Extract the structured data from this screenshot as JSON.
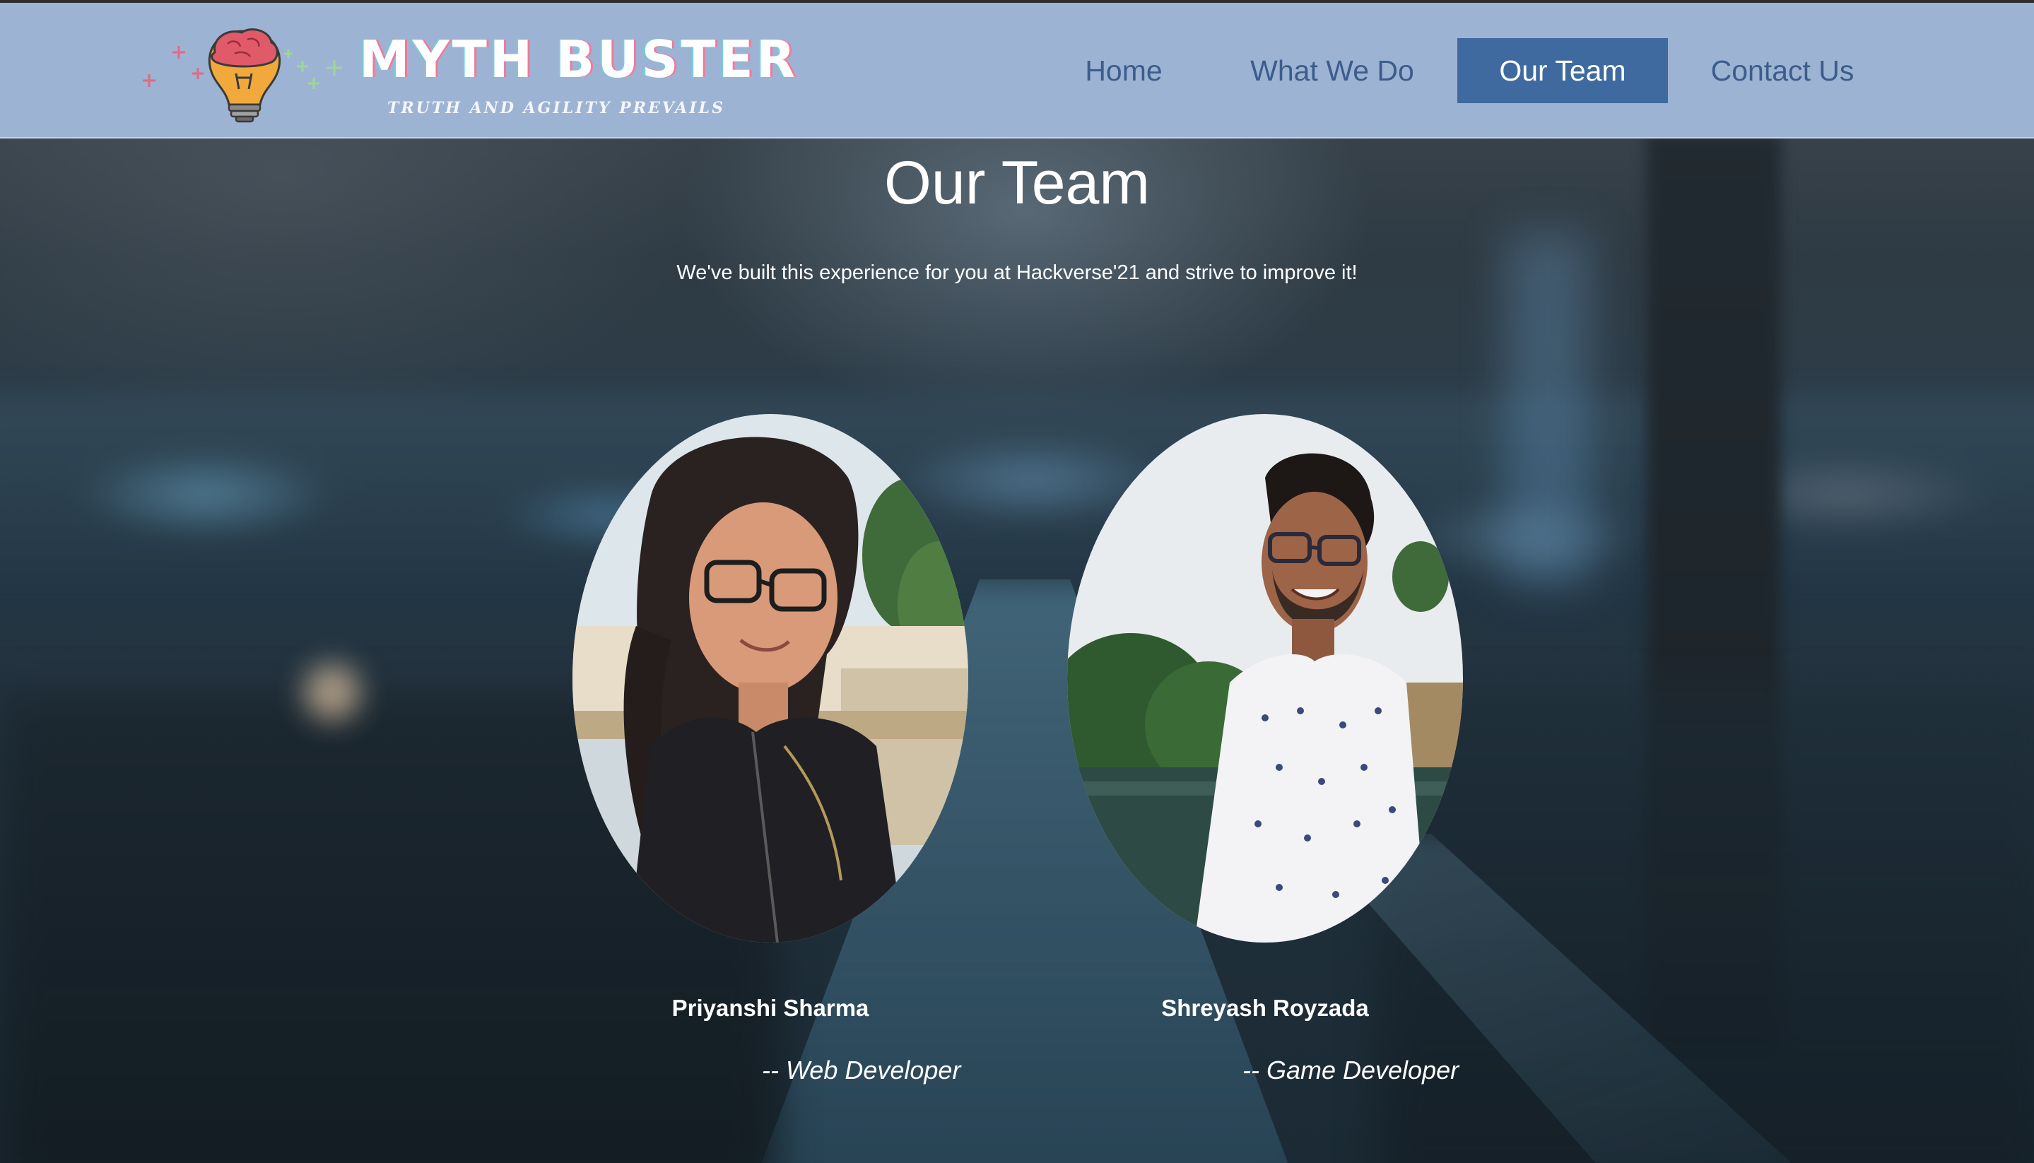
{
  "brand": {
    "title": "MYTH BUSTER",
    "tagline": "TRUTH AND AGILITY PREVAILS",
    "logo_icon": "lightbulb-brain-icon"
  },
  "nav": {
    "items": [
      {
        "label": "Home",
        "active": false
      },
      {
        "label": "What We Do",
        "active": false
      },
      {
        "label": "Our Team",
        "active": true
      },
      {
        "label": "Contact Us",
        "active": false
      }
    ]
  },
  "main": {
    "title": "Our Team",
    "subtitle": "We've built this experience for you at Hackverse'21 and strive to improve it!"
  },
  "team": [
    {
      "name": "Priyanshi Sharma",
      "role": "-- Web Developer"
    },
    {
      "name": "Shreyash Royzada",
      "role": "-- Game Developer"
    }
  ],
  "colors": {
    "header_bg": "#9db3d3",
    "nav_text": "#3c5d8c",
    "nav_active_bg": "#3f6aa0",
    "text_light": "#ffffff"
  }
}
